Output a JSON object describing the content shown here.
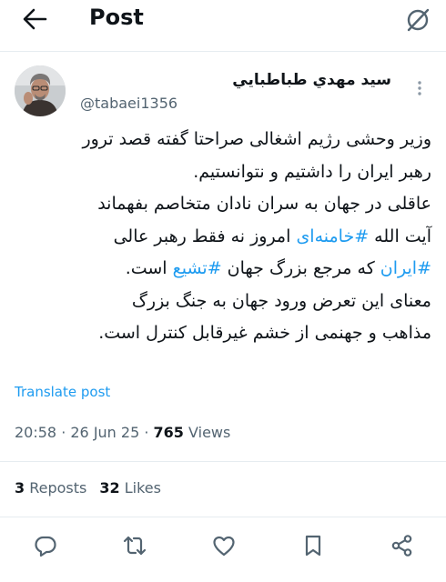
{
  "header": {
    "title": "Post"
  },
  "author": {
    "name": "سید مهدي طباطبايي",
    "handle": "@tabaei1356"
  },
  "post": {
    "lines": [
      [
        {
          "t": "وزیر وحشی رژیم اشغالی صراحتا گفته قصد ترور"
        }
      ],
      [
        {
          "t": "رهبر ایران را داشتیم و نتوانستیم."
        }
      ],
      [
        {
          "t": "عاقلی در جهان به سران نادان متخاصم بفهماند"
        }
      ],
      [
        {
          "t": "آیت الله "
        },
        {
          "t": "#خامنه‌ای",
          "tag": true
        },
        {
          "t": " امروز نه فقط رهبر عالی"
        }
      ],
      [
        {
          "t": "#ایران",
          "tag": true
        },
        {
          "t": " که مرجع بزرگ جهان "
        },
        {
          "t": "#تشیع",
          "tag": true
        },
        {
          "t": " است."
        }
      ],
      [
        {
          "t": "معنای این تعرض ورود جهان به جنگ بزرگ"
        }
      ],
      [
        {
          "t": "مذاهب و جهنمی از خشم غیرقابل کنترل است."
        }
      ]
    ],
    "translate_label": "Translate post",
    "time": "20:58",
    "date": "26 Jun 25",
    "views_count": "765",
    "views_label": "Views"
  },
  "stats": {
    "reposts_count": "3",
    "reposts_label": "Reposts",
    "likes_count": "32",
    "likes_label": "Likes"
  },
  "icons": [
    "back-arrow-icon",
    "grok-icon",
    "more-icon",
    "reply-icon",
    "repost-icon",
    "like-icon",
    "bookmark-icon",
    "share-icon"
  ],
  "colors": {
    "accent": "#1d9bf0",
    "text": "#0f1419",
    "muted": "#536471"
  }
}
